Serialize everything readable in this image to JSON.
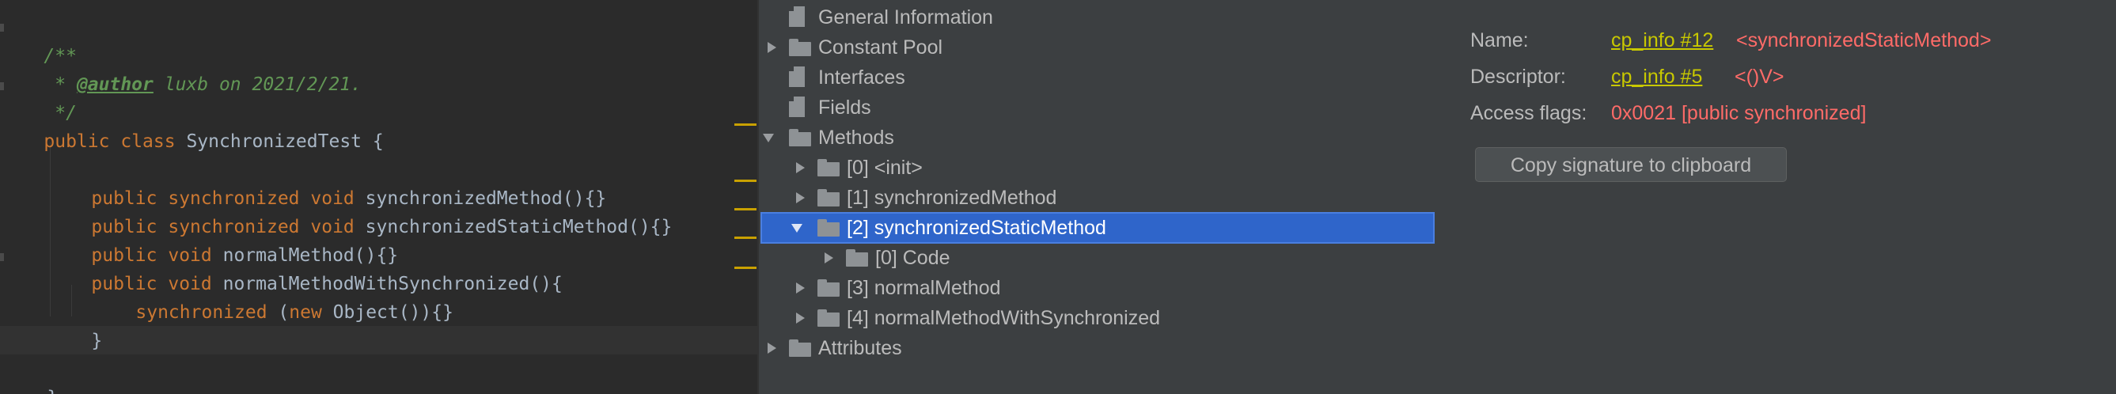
{
  "editor": {
    "comment_open": "/**",
    "comment_author_prefix": " * ",
    "comment_author_tag": "@author",
    "comment_author_text": " luxb on 2021/2/21.",
    "comment_close": " */",
    "class_kw_public": "public",
    "class_kw_class": "class",
    "class_name": "SynchronizedTest",
    "class_brace": " {",
    "m1_public": "public",
    "m1_sync": "synchronized",
    "m1_void": "void",
    "m1_name": "synchronizedMethod",
    "m1_rest": "(){}",
    "m2_public": "public",
    "m2_sync": "synchronized",
    "m2_void": "void",
    "m2_name": "synchronizedStaticMethod",
    "m2_rest": "(){}",
    "m3_public": "public",
    "m3_void": "void",
    "m3_name": "normalMethod",
    "m3_rest": "(){}",
    "m4_public": "public",
    "m4_void": "void",
    "m4_name": "normalMethodWithSynchronized",
    "m4_rest": "(){",
    "sync_kw": "synchronized",
    "sync_paren": " (",
    "new_kw": "new",
    "sync_rest": " Object()){}",
    "inner_close": "}",
    "class_close": "}"
  },
  "tree": {
    "general": "General Information",
    "constant_pool": "Constant Pool",
    "interfaces": "Interfaces",
    "fields": "Fields",
    "methods": "Methods",
    "method_0": "[0] <init>",
    "method_1": "[1] synchronizedMethod",
    "method_2": "[2] synchronizedStaticMethod",
    "method_2_code": "[0] Code",
    "method_3": "[3] normalMethod",
    "method_4": "[4] normalMethodWithSynchronized",
    "attributes": "Attributes"
  },
  "details": {
    "name_label": "Name:",
    "name_link": "cp_info #12",
    "name_value": "<synchronizedStaticMethod>",
    "descriptor_label": "Descriptor:",
    "descriptor_link": "cp_info #5",
    "descriptor_value": "<()V>",
    "access_label": "Access flags:",
    "access_value": "0x0021 [public synchronized]",
    "copy_button": "Copy signature to clipboard"
  },
  "colors": {
    "editor_bg": "#2b2b2b",
    "keyword": "#cc7832",
    "comment": "#629755",
    "panel_bg": "#3c3f41",
    "selection": "#2f65ca",
    "link": "#c8c800",
    "value": "#ff6b68"
  }
}
